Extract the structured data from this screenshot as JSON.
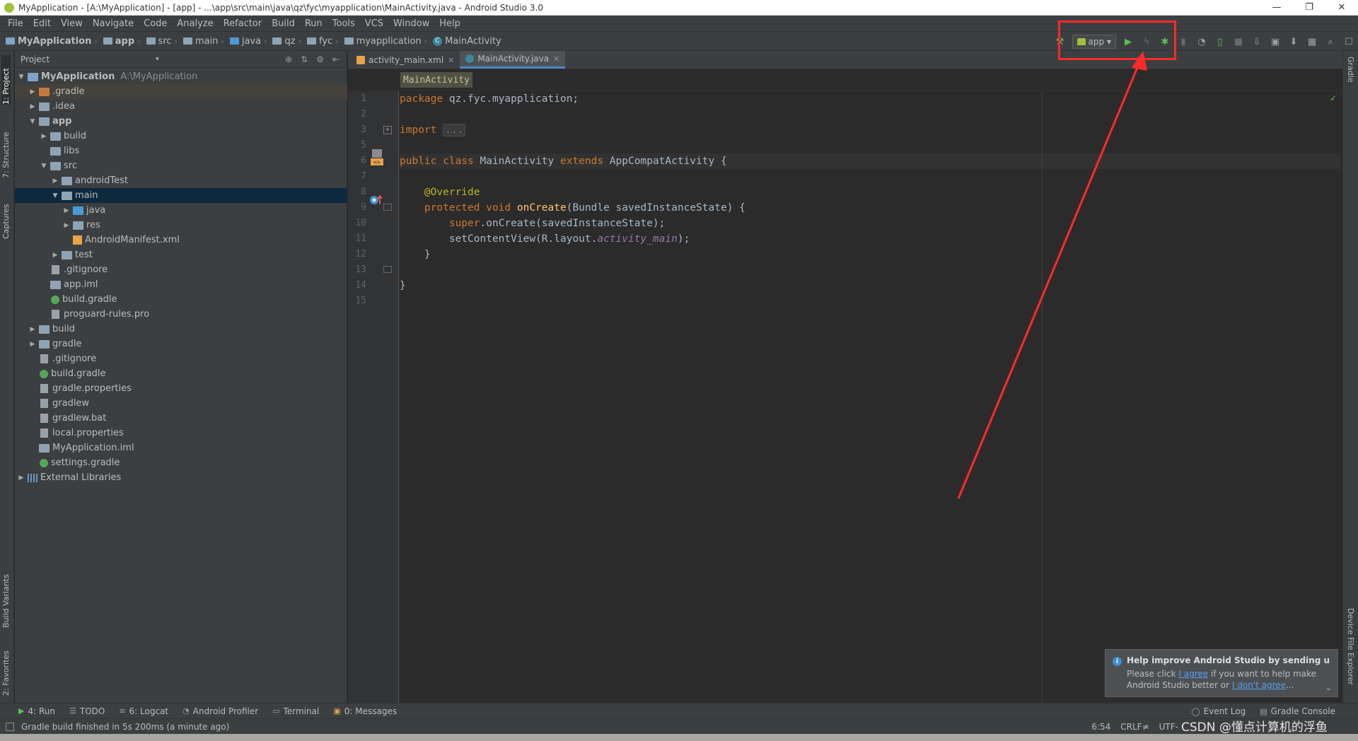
{
  "window": {
    "title": "MyApplication - [A:\\MyApplication] - [app] - ...\\app\\src\\main\\java\\qz\\fyc\\myapplication\\MainActivity.java - Android Studio 3.0",
    "minimize": "—",
    "restore": "❐",
    "close": "✕"
  },
  "menu": [
    "File",
    "Edit",
    "View",
    "Navigate",
    "Code",
    "Analyze",
    "Refactor",
    "Build",
    "Run",
    "Tools",
    "VCS",
    "Window",
    "Help"
  ],
  "breadcrumbs": [
    "MyApplication",
    "app",
    "src",
    "main",
    "java",
    "qz",
    "fyc",
    "myapplication",
    "MainActivity"
  ],
  "toolbar": {
    "run_config": "app"
  },
  "left_tabs": [
    "1: Project",
    "7: Structure",
    "Captures",
    "Build Variants",
    "2: Favorites"
  ],
  "right_tabs": [
    "Gradle",
    "Device File Explorer"
  ],
  "project_panel": {
    "header": "Project",
    "tree": [
      {
        "label": "MyApplication",
        "path": "A:\\MyApplication"
      },
      {
        "label": ".gradle"
      },
      {
        "label": ".idea"
      },
      {
        "label": "app"
      },
      {
        "label": "build"
      },
      {
        "label": "libs"
      },
      {
        "label": "src"
      },
      {
        "label": "androidTest"
      },
      {
        "label": "main"
      },
      {
        "label": "java"
      },
      {
        "label": "res"
      },
      {
        "label": "AndroidManifest.xml"
      },
      {
        "label": "test"
      },
      {
        "label": ".gitignore"
      },
      {
        "label": "app.iml"
      },
      {
        "label": "build.gradle"
      },
      {
        "label": "proguard-rules.pro"
      },
      {
        "label": "build"
      },
      {
        "label": "gradle"
      },
      {
        "label": ".gitignore"
      },
      {
        "label": "build.gradle"
      },
      {
        "label": "gradle.properties"
      },
      {
        "label": "gradlew"
      },
      {
        "label": "gradlew.bat"
      },
      {
        "label": "local.properties"
      },
      {
        "label": "MyApplication.iml"
      },
      {
        "label": "settings.gradle"
      },
      {
        "label": "External Libraries"
      }
    ]
  },
  "editor": {
    "tabs": [
      {
        "label": "activity_main.xml"
      },
      {
        "label": "MainActivity.java"
      }
    ],
    "class_crumb": "MainActivity",
    "line_numbers": [
      "1",
      "2",
      "3",
      "5",
      "6",
      "7",
      "8",
      "9",
      "10",
      "11",
      "12",
      "13",
      "14",
      "15"
    ],
    "code": {
      "l1_kw": "package",
      "l1_rest": " qz.fyc.myapplication;",
      "l3_kw": "import",
      "l3_fold": "...",
      "l6_kw1": "public class",
      "l6_name": " MainActivity ",
      "l6_kw2": "extends",
      "l6_rest": " AppCompatActivity {",
      "l8_ann": "@Override",
      "l9_kw": "protected void",
      "l9_fn": "onCreate",
      "l9_rest": "(Bundle savedInstanceState) {",
      "l10_kw": "super",
      "l10_rest": ".onCreate(savedInstanceState);",
      "l11_pre": "setContentView(R.layout.",
      "l11_fld": "activity_main",
      "l11_post": ");",
      "l12": "}",
      "l14": "}"
    }
  },
  "notification": {
    "title": "Help improve Android Studio by sending u:",
    "text_1": "Please click ",
    "link_agree": "I agree",
    "text_2": " if you want to help make",
    "text_3": "Android Studio better or ",
    "link_disagree": "I don't agree",
    "text_4": "..."
  },
  "bottom_tools": [
    "4: Run",
    "TODO",
    "6: Logcat",
    "Android Profiler",
    "Terminal",
    "0: Messages"
  ],
  "bottom_right_tools": [
    "Event Log",
    "Gradle Console"
  ],
  "status": {
    "message": "Gradle build finished in 5s 200ms (a minute ago)",
    "position": "6:54",
    "line_sep": "CRLF≠",
    "encoding": "UTF-"
  },
  "watermark": "CSDN @懂点计算机的浮鱼",
  "colors": {
    "highlight": "#ff2a2a",
    "keyword": "#cc7832",
    "annotation": "#bbb529",
    "function": "#ffc66d",
    "field": "#9876aa",
    "selection": "#0d293e"
  }
}
